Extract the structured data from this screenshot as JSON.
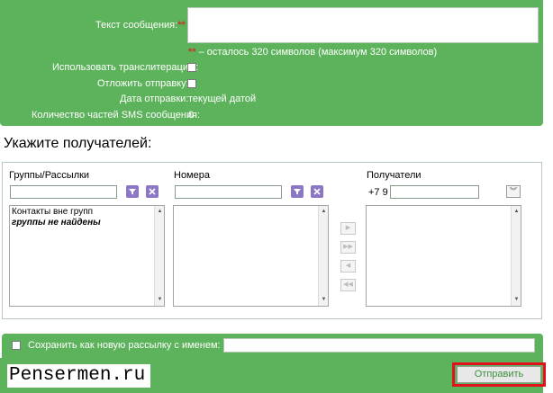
{
  "form": {
    "message_label": "Текст сообщения:",
    "required_mark": "**",
    "chars_note_mark": "**",
    "chars_note": " – осталось 320 символов (максимум 320 символов)",
    "translit_label": "Использовать транслитерацию:",
    "delay_label": "Отложить отправку:",
    "send_date_label": "Дата отправки:",
    "send_date_value": "текущей датой",
    "sms_parts_label": "Количество частей SMS сообщения:",
    "sms_parts_value": "0"
  },
  "recipients": {
    "title": "Укажите получателей:",
    "groups": {
      "header": "Группы/Рассылки",
      "items": [
        "Контакты вне групп"
      ],
      "empty_note": "группы не найдены"
    },
    "numbers": {
      "header": "Номера"
    },
    "selected": {
      "header": "Получатели",
      "phone_prefix": "+7 9"
    }
  },
  "save_list": {
    "label": "Сохранить как новую рассылку с именем:"
  },
  "footer": {
    "watermark": "Pensermen.ru",
    "send_button": "Отправить"
  },
  "colors": {
    "panel_green": "#5db35b",
    "highlight_red": "#e0121d",
    "filter_icon": "#8b77c4"
  },
  "icons": {
    "filter": "funnel-icon",
    "clear": "close-icon",
    "expand": "double-chevron-down-icon",
    "move_right": "arrow-right-icon",
    "move_all_right": "double-arrow-right-icon",
    "move_left": "arrow-left-icon",
    "move_all_left": "double-arrow-left-icon"
  }
}
